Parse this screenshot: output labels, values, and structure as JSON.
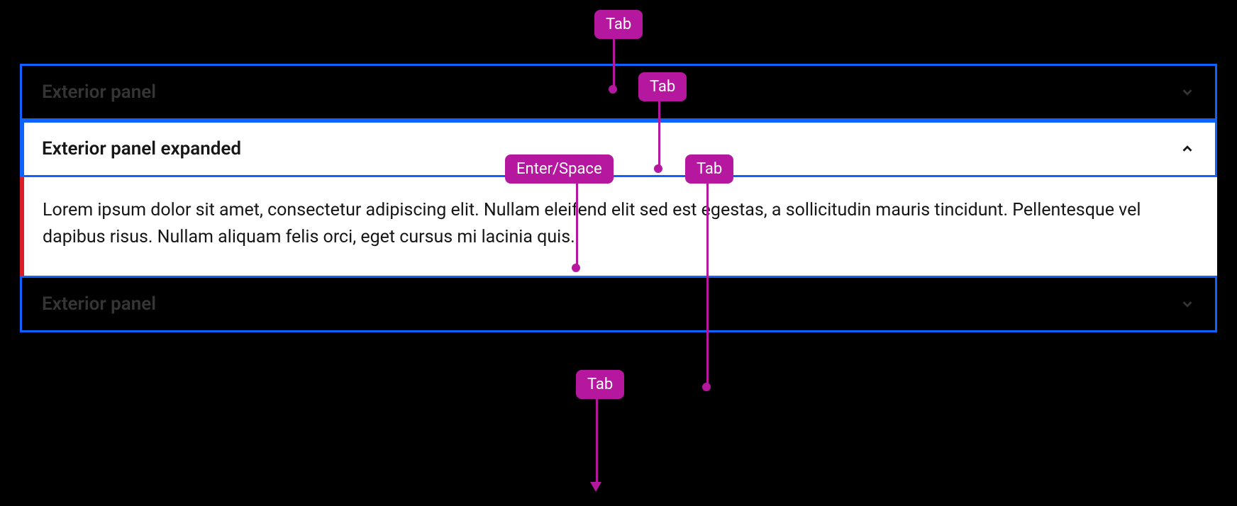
{
  "badges": {
    "tab1": "Tab",
    "tab2": "Tab",
    "enter_space": "Enter/Space",
    "tab3": "Tab",
    "tab4": "Tab"
  },
  "panels": {
    "panel1": {
      "title": "Exterior panel"
    },
    "panel2": {
      "title": "Exterior panel expanded"
    },
    "panel3": {
      "title": "Exterior panel"
    }
  },
  "content": "Lorem ipsum dolor sit amet, consectetur adipiscing elit. Nullam eleifend elit sed est egestas, a sollicitudin mauris tincidunt. Pellentesque vel dapibus risus. Nullam aliquam felis orci, eget cursus mi lacinia quis."
}
